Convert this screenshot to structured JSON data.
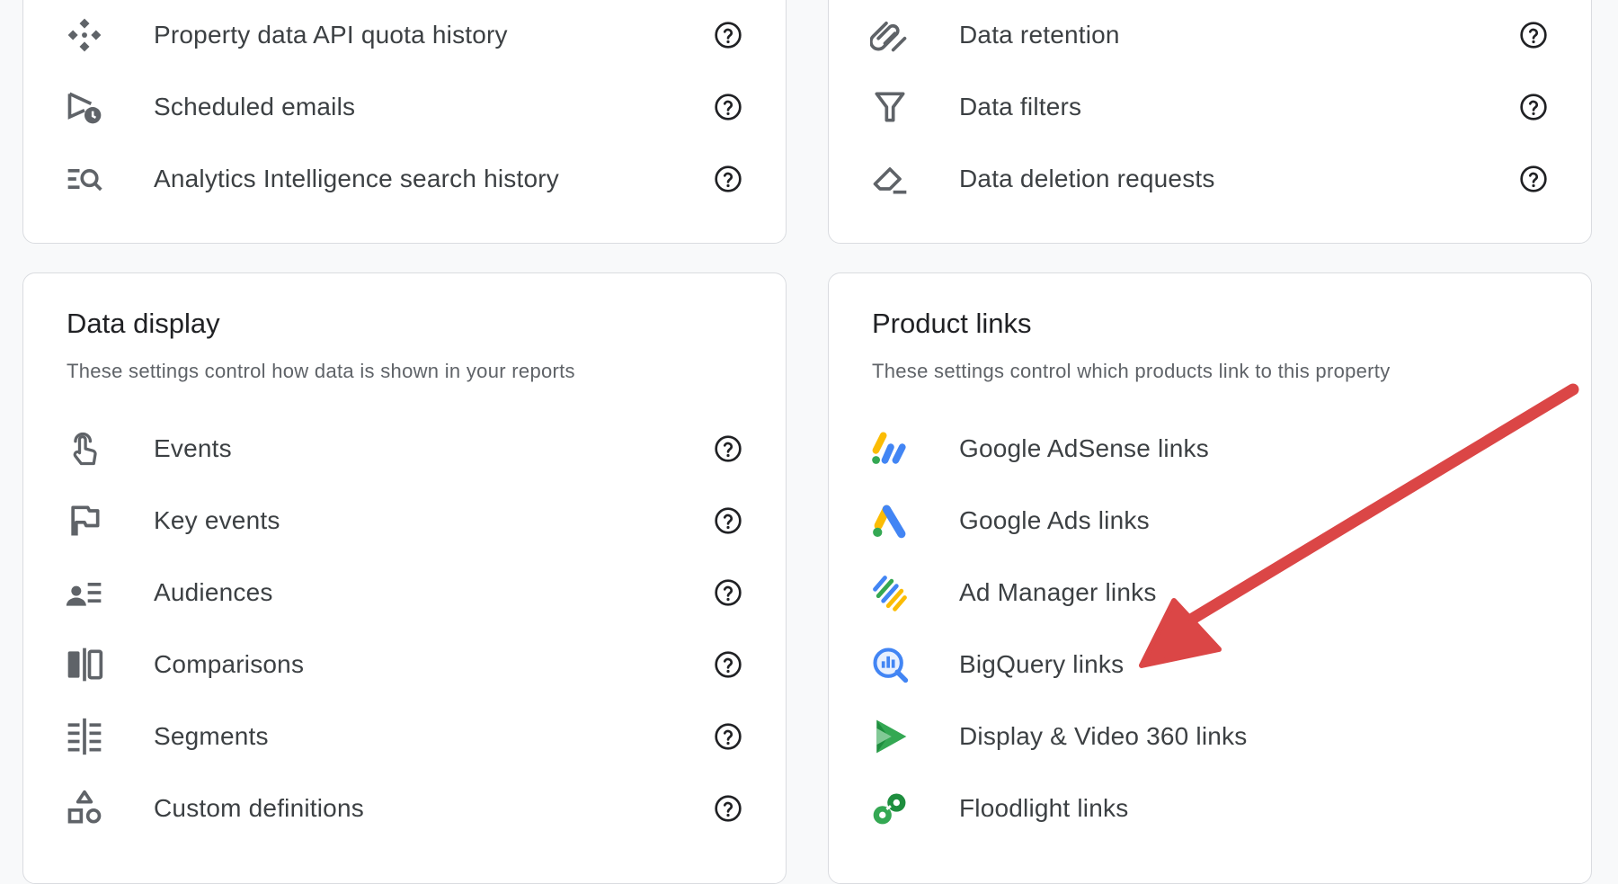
{
  "top_left_card": {
    "items": [
      {
        "label": "Property data API quota history",
        "icon": "api-quota-icon"
      },
      {
        "label": "Scheduled emails",
        "icon": "scheduled-email-icon"
      },
      {
        "label": "Analytics Intelligence search history",
        "icon": "search-history-icon"
      }
    ]
  },
  "top_right_card": {
    "items": [
      {
        "label": "Data retention",
        "icon": "data-retention-icon"
      },
      {
        "label": "Data filters",
        "icon": "filter-icon"
      },
      {
        "label": "Data deletion requests",
        "icon": "eraser-icon"
      }
    ]
  },
  "data_display": {
    "title": "Data display",
    "subtitle": "These settings control how data is shown in your reports",
    "items": [
      {
        "label": "Events",
        "icon": "touch-icon"
      },
      {
        "label": "Key events",
        "icon": "flag-icon"
      },
      {
        "label": "Audiences",
        "icon": "audiences-icon"
      },
      {
        "label": "Comparisons",
        "icon": "comparisons-icon"
      },
      {
        "label": "Segments",
        "icon": "segments-icon"
      },
      {
        "label": "Custom definitions",
        "icon": "shapes-icon"
      }
    ]
  },
  "product_links": {
    "title": "Product links",
    "subtitle": "These settings control which products link to this property",
    "items": [
      {
        "label": "Google AdSense links",
        "icon": "adsense-logo-icon"
      },
      {
        "label": "Google Ads links",
        "icon": "google-ads-logo-icon"
      },
      {
        "label": "Ad Manager links",
        "icon": "ad-manager-logo-icon"
      },
      {
        "label": "BigQuery links",
        "icon": "bigquery-logo-icon"
      },
      {
        "label": "Display & Video 360 links",
        "icon": "dv360-logo-icon"
      },
      {
        "label": "Floodlight links",
        "icon": "floodlight-logo-icon"
      }
    ]
  },
  "colors": {
    "google_blue": "#4285f4",
    "google_yellow": "#fbbc04",
    "google_green": "#34a853",
    "annotation_arrow": "#db4646"
  }
}
